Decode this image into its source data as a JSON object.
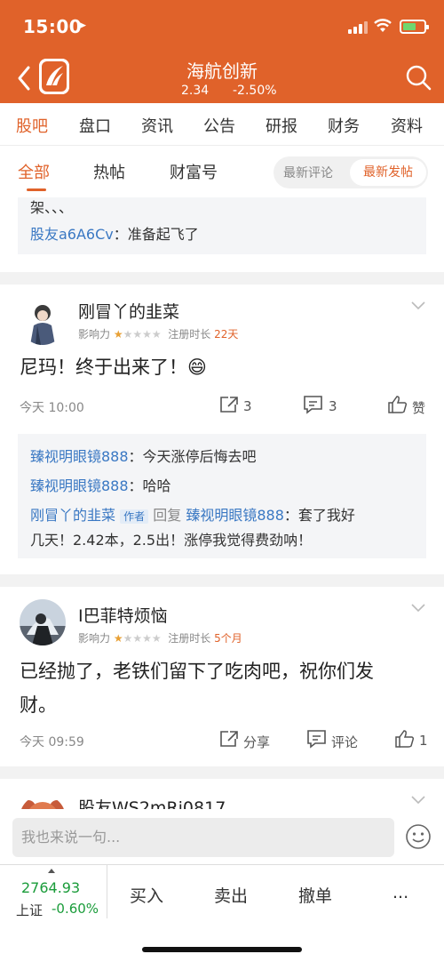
{
  "status_bar": {
    "time": "15:00",
    "location_icon": "location-arrow-icon",
    "battery_color": "#6fd66f"
  },
  "header": {
    "title": "海航创新",
    "price": "2.34",
    "change": "-2.50%",
    "back_icon": "back-chevron-icon",
    "search_icon": "search-icon",
    "bg_color": "#e0622a"
  },
  "main_tabs": [
    "股吧",
    "盘口",
    "资讯",
    "公告",
    "研报",
    "财务",
    "资料"
  ],
  "main_tab_active": "股吧",
  "sub_tabs": [
    "全部",
    "热帖",
    "财富号"
  ],
  "sort": {
    "option_comment": "最新评论",
    "option_post": "最新发帖",
    "active": "最新发帖"
  },
  "feed": {
    "prev_tail": {
      "text": "架、、、",
      "reply_user": "股友a6A6Cv",
      "reply_text": "：准备起飞了"
    },
    "posts": [
      {
        "author": "刚冒丫的韭菜",
        "influence_label": "影响力",
        "stars_on": "★",
        "stars_off": "★★★★",
        "reg_label": "注册时长",
        "reg_value": "22天",
        "content": "尼玛！终于出来了！😄",
        "time": "今天 10:00",
        "share_count": "3",
        "comment_count": "3",
        "like_label": "赞",
        "replies": [
          {
            "user": "臻视明眼镜888",
            "text": "：今天涨停后悔去吧"
          },
          {
            "user": "臻视明眼镜888",
            "text": "：哈哈"
          }
        ],
        "reply_author": "刚冒丫的韭菜",
        "author_tag": "作者",
        "reply_word": "回复",
        "reply_target": "臻视明眼镜888",
        "reply_text_1": "：套了我好",
        "reply_text_2": "几天！2.42本，2.5出！涨停我觉得费劲呐！"
      },
      {
        "author": "I巴菲特烦恼",
        "influence_label": "影响力",
        "stars_on": "★",
        "stars_off": "★★★★",
        "reg_label": "注册时长",
        "reg_value": "5个月",
        "content_line_1": "已经抛了，老铁们留下了吃肉吧，祝你们发",
        "content_line_2": "财。",
        "time": "今天 09:59",
        "share_label": "分享",
        "comment_label": "评论",
        "like_count": "1"
      },
      {
        "author": "股友WS2mRj0817"
      }
    ]
  },
  "comment_bar": {
    "placeholder": "我也来说一句...",
    "emoji_icon": "smiley-icon"
  },
  "index": {
    "value": "2764.93",
    "name": "上证",
    "change": "-0.60%"
  },
  "trade": {
    "buy": "买入",
    "sell": "卖出",
    "cancel": "撤单",
    "more": "..."
  },
  "colors": {
    "accent": "#e0622a",
    "link": "#3a78c3",
    "down": "#1a9c3a"
  }
}
